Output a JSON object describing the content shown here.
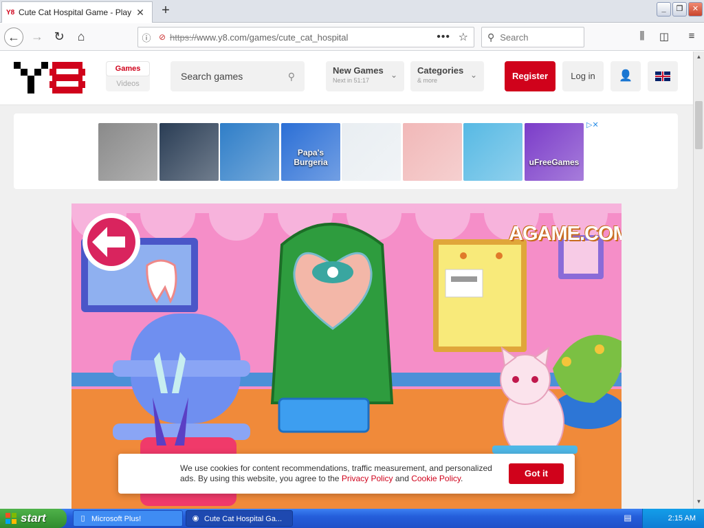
{
  "browser": {
    "tab_title": "Cute Cat Hospital Game - Play onli",
    "tab_favicon": "Y8",
    "new_tab": "+",
    "url_scheme": "https://",
    "url_host": "www.y8.com/games/cute_cat_hospital",
    "search_placeholder": "Search"
  },
  "site": {
    "games_tab": "Games",
    "videos_tab": "Videos",
    "search_placeholder": "Search games",
    "new_games": {
      "title": "New Games",
      "sub": "Next in 51:17"
    },
    "categories": {
      "title": "Categories",
      "sub": "& more"
    },
    "register": "Register",
    "login": "Log in"
  },
  "ads": {
    "thumbs": [
      {
        "label": "",
        "color": "#8a8a8a"
      },
      {
        "label": "",
        "color": "#2a3d55"
      },
      {
        "label": "",
        "color": "#2f7ec8"
      },
      {
        "label": "Papa's Burgeria",
        "color": "#2b6fd6"
      },
      {
        "label": "",
        "color": "#e9eef2"
      },
      {
        "label": "",
        "color": "#f1b8b8"
      },
      {
        "label": "",
        "color": "#57b9e4"
      },
      {
        "label": "uFreeGames",
        "color": "#7b3cc9"
      }
    ],
    "close_label": "▷✕"
  },
  "game": {
    "logo": "AGAME.COM"
  },
  "cookie": {
    "text_1": "We use cookies for content recommendations, traffic measurement, and personalized ads. By using this website, you agree to the",
    "privacy_link": "Privacy Policy",
    "and": "and",
    "cookie_link": "Cookie Policy",
    "period": ".",
    "button": "Got it"
  },
  "taskbar": {
    "start": "start",
    "items": [
      {
        "label": "Microsoft Plus!"
      },
      {
        "label": "Cute Cat Hospital Ga..."
      }
    ],
    "clock": "2:15 AM"
  },
  "colors": {
    "brand_red": "#d0021b",
    "game_pink": "#f58ec8",
    "xp_blue": "#245edb"
  }
}
